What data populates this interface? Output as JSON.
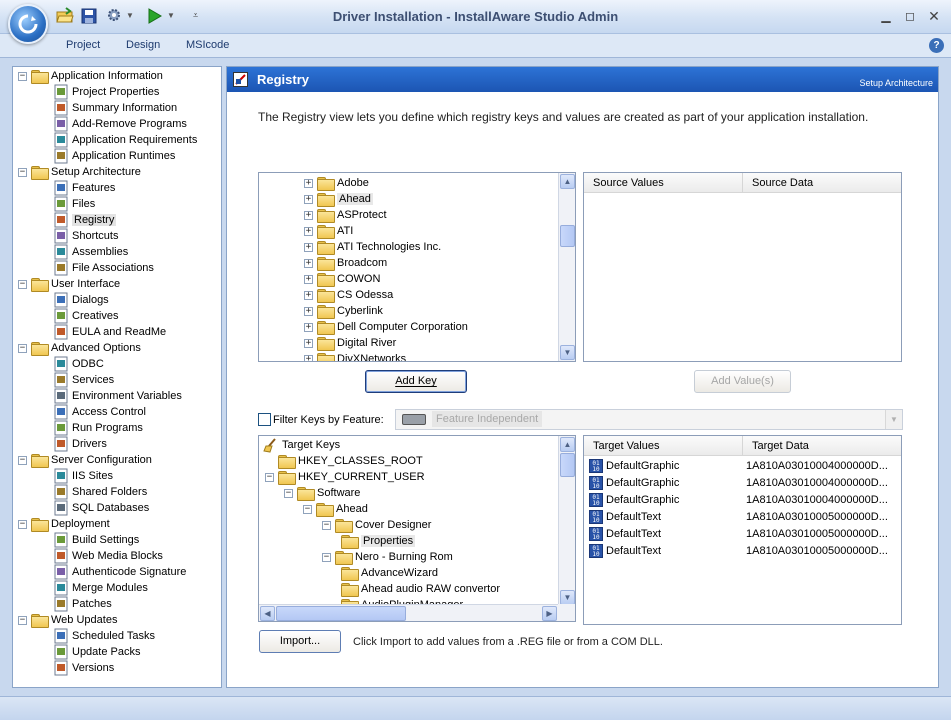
{
  "window": {
    "title": "Driver Installation - InstallAware Studio Admin"
  },
  "ribbon": {
    "tabs": [
      "Project",
      "Design",
      "MSIcode"
    ]
  },
  "nav": {
    "items": [
      {
        "label": "Application Information",
        "level": 0,
        "kind": "folder",
        "icon": "folder-icon"
      },
      {
        "label": "Project Properties",
        "level": 1,
        "icon": "properties-icon"
      },
      {
        "label": "Summary Information",
        "level": 1,
        "icon": "summary-icon"
      },
      {
        "label": "Add-Remove Programs",
        "level": 1,
        "icon": "add-remove-icon"
      },
      {
        "label": "Application Requirements",
        "level": 1,
        "icon": "requirements-icon"
      },
      {
        "label": "Application Runtimes",
        "level": 1,
        "icon": "runtimes-icon"
      },
      {
        "label": "Setup Architecture",
        "level": 0,
        "kind": "folder",
        "icon": "folder-icon"
      },
      {
        "label": "Features",
        "level": 1,
        "icon": "features-icon"
      },
      {
        "label": "Files",
        "level": 1,
        "icon": "files-icon"
      },
      {
        "label": "Registry",
        "level": 1,
        "icon": "registry-icon",
        "selected": true
      },
      {
        "label": "Shortcuts",
        "level": 1,
        "icon": "shortcuts-icon"
      },
      {
        "label": "Assemblies",
        "level": 1,
        "icon": "assemblies-icon"
      },
      {
        "label": "File Associations",
        "level": 1,
        "icon": "file-associations-icon"
      },
      {
        "label": "User Interface",
        "level": 0,
        "kind": "folder",
        "icon": "folder-icon"
      },
      {
        "label": "Dialogs",
        "level": 1,
        "icon": "dialogs-icon"
      },
      {
        "label": "Creatives",
        "level": 1,
        "icon": "creatives-icon"
      },
      {
        "label": "EULA and ReadMe",
        "level": 1,
        "icon": "eula-icon"
      },
      {
        "label": "Advanced Options",
        "level": 0,
        "kind": "folder",
        "icon": "folder-icon"
      },
      {
        "label": "ODBC",
        "level": 1,
        "icon": "odbc-icon"
      },
      {
        "label": "Services",
        "level": 1,
        "icon": "services-icon"
      },
      {
        "label": "Environment Variables",
        "level": 1,
        "icon": "environment-icon"
      },
      {
        "label": "Access Control",
        "level": 1,
        "icon": "access-control-icon"
      },
      {
        "label": "Run Programs",
        "level": 1,
        "icon": "run-programs-icon"
      },
      {
        "label": "Drivers",
        "level": 1,
        "icon": "drivers-icon"
      },
      {
        "label": "Server Configuration",
        "level": 0,
        "kind": "folder",
        "icon": "folder-icon"
      },
      {
        "label": "IIS Sites",
        "level": 1,
        "icon": "iis-icon"
      },
      {
        "label": "Shared Folders",
        "level": 1,
        "icon": "shared-folders-icon"
      },
      {
        "label": "SQL Databases",
        "level": 1,
        "icon": "sql-icon"
      },
      {
        "label": "Deployment",
        "level": 0,
        "kind": "folder",
        "icon": "folder-icon"
      },
      {
        "label": "Build Settings",
        "level": 1,
        "icon": "build-icon"
      },
      {
        "label": "Web Media Blocks",
        "level": 1,
        "icon": "web-media-icon"
      },
      {
        "label": "Authenticode Signature",
        "level": 1,
        "icon": "signature-icon"
      },
      {
        "label": "Merge Modules",
        "level": 1,
        "icon": "merge-modules-icon"
      },
      {
        "label": "Patches",
        "level": 1,
        "icon": "patches-icon"
      },
      {
        "label": "Web Updates",
        "level": 0,
        "kind": "folder",
        "icon": "folder-icon"
      },
      {
        "label": "Scheduled Tasks",
        "level": 1,
        "icon": "scheduled-tasks-icon"
      },
      {
        "label": "Update Packs",
        "level": 1,
        "icon": "update-packs-icon"
      },
      {
        "label": "Versions",
        "level": 1,
        "icon": "versions-icon"
      }
    ]
  },
  "panel": {
    "title": "Registry",
    "subtitle": "Setup Architecture",
    "description": "The Registry view lets you define which registry keys and values are created as part of your application installation."
  },
  "source": {
    "keys": [
      "Adobe",
      "Ahead",
      "ASProtect",
      "ATI",
      "ATI Technologies Inc.",
      "Broadcom",
      "COWON",
      "CS Odessa",
      "Cyberlink",
      "Dell Computer Corporation",
      "Digital River",
      "DivXNetworks"
    ],
    "columns": [
      "Source Values",
      "Source Data"
    ],
    "add_key": "Add Key",
    "add_values": "Add Value(s)"
  },
  "filter": {
    "label": "Filter Keys by Feature:",
    "feature": "Feature Independent"
  },
  "target": {
    "keys": [
      {
        "label": "Target Keys",
        "depth": 0
      },
      {
        "label": "HKEY_CLASSES_ROOT",
        "depth": 1
      },
      {
        "label": "HKEY_CURRENT_USER",
        "depth": 1
      },
      {
        "label": "Software",
        "depth": 2
      },
      {
        "label": "Ahead",
        "depth": 3
      },
      {
        "label": "Cover Designer",
        "depth": 4
      },
      {
        "label": "Properties",
        "depth": 5,
        "selected": true
      },
      {
        "label": "Nero - Burning Rom",
        "depth": 4
      },
      {
        "label": "AdvanceWizard",
        "depth": 5
      },
      {
        "label": "Ahead audio RAW convertor",
        "depth": 5
      },
      {
        "label": "AudioPluginManager",
        "depth": 5
      }
    ],
    "columns": [
      "Target Values",
      "Target Data"
    ],
    "values": [
      {
        "name": "DefaultGraphic",
        "data": "1A810A03010004000000D..."
      },
      {
        "name": "DefaultGraphic",
        "data": "1A810A03010004000000D..."
      },
      {
        "name": "DefaultGraphic",
        "data": "1A810A03010004000000D..."
      },
      {
        "name": "DefaultText",
        "data": "1A810A03010005000000D..."
      },
      {
        "name": "DefaultText",
        "data": "1A810A03010005000000D..."
      },
      {
        "name": "DefaultText",
        "data": "1A810A03010005000000D..."
      }
    ]
  },
  "import": {
    "button": "Import...",
    "hint": "Click Import to add values from a .REG file or from a COM DLL."
  }
}
